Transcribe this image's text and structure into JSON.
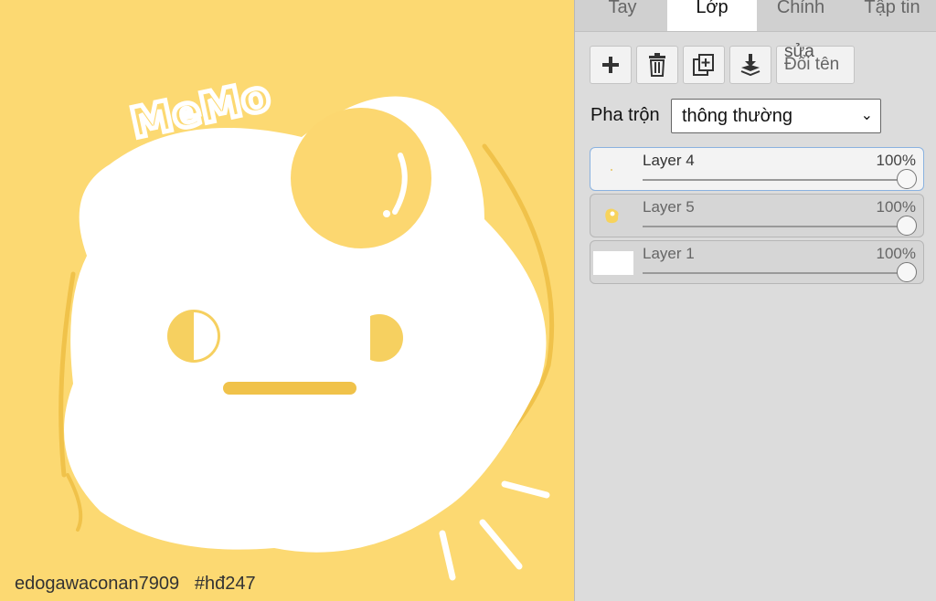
{
  "canvas": {
    "background_color": "#fcd972",
    "sketch_text": "MeMo",
    "caption_user": "edogawaconan7909",
    "caption_tag": "#hđ247"
  },
  "tabs": [
    {
      "label": "Tay",
      "active": false
    },
    {
      "label": "Lớp",
      "active": true
    },
    {
      "label": "Chỉnh",
      "active": false
    },
    {
      "label": "Tập tin",
      "active": false
    }
  ],
  "toolbar": {
    "add_icon": "plus-icon",
    "delete_icon": "trash-icon",
    "duplicate_icon": "duplicate-layer-icon",
    "merge_icon": "merge-down-icon",
    "rename_sup": "sửa",
    "rename_label": "Đổi tên"
  },
  "blend": {
    "label": "Pha trộn",
    "selected": "thông thường"
  },
  "layers": [
    {
      "name": "Layer 4",
      "opacity": "100%",
      "opacity_value": 1.0,
      "active": true
    },
    {
      "name": "Layer 5",
      "opacity": "100%",
      "opacity_value": 1.0,
      "active": false
    },
    {
      "name": "Layer 1",
      "opacity": "100%",
      "opacity_value": 1.0,
      "active": false
    }
  ]
}
